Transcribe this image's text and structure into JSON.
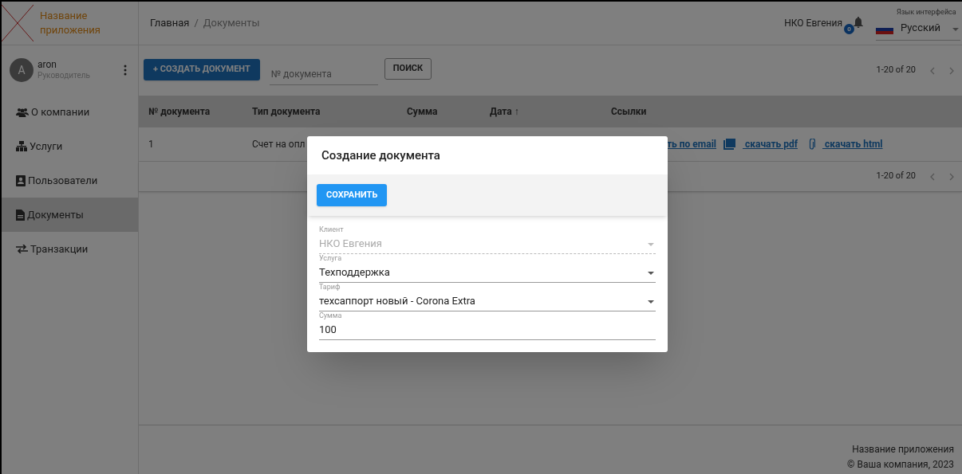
{
  "app": {
    "name": "Название приложения"
  },
  "user": {
    "initial": "A",
    "name": "aron",
    "role": "Руководитель"
  },
  "sidebar": {
    "items": [
      {
        "label": "О компании",
        "selected": false
      },
      {
        "label": "Услуги",
        "selected": false
      },
      {
        "label": "Пользователи",
        "selected": false
      },
      {
        "label": "Документы",
        "selected": true
      },
      {
        "label": "Транзакции",
        "selected": false
      }
    ]
  },
  "breadcrumbs": [
    "Главная",
    "/",
    "Документы"
  ],
  "header": {
    "account": "НКО Евгения",
    "notifications": "0",
    "language_label": "Язык интерфейса",
    "language": "Русский"
  },
  "toolbar": {
    "create_button": "+ СОЗДАТЬ ДОКУМЕНТ",
    "search_placeholder": "№ документа",
    "search_button": "ПОИСК",
    "pagination": "1-20 of 20"
  },
  "table": {
    "columns": [
      "№ документа",
      "Тип документа",
      "Сумма",
      "Дата ↑",
      "Ссылки"
    ],
    "rows": [
      {
        "number": "1",
        "type": "Счет на опл",
        "links": [
          "ть по email",
          " скачать pdf",
          " скачать html"
        ]
      }
    ],
    "pagination": "1-20 of 20"
  },
  "footer": {
    "app_name": "Название приложения",
    "copyright": "© Ваша компания, 2023"
  },
  "dialog": {
    "title": "Создание документа",
    "save_button": "СОХРАНИТЬ",
    "fields": [
      {
        "label": "Клиент",
        "value": "НКО Евгения",
        "kind": "select",
        "disabled": true
      },
      {
        "label": "Услуга",
        "value": "Техподдержка",
        "kind": "select",
        "disabled": false
      },
      {
        "label": "Тариф",
        "value": "техсаппорт новый - Corona Extra",
        "kind": "select",
        "disabled": false
      },
      {
        "label": "Сумма",
        "value": "100",
        "kind": "text",
        "disabled": false
      }
    ]
  }
}
